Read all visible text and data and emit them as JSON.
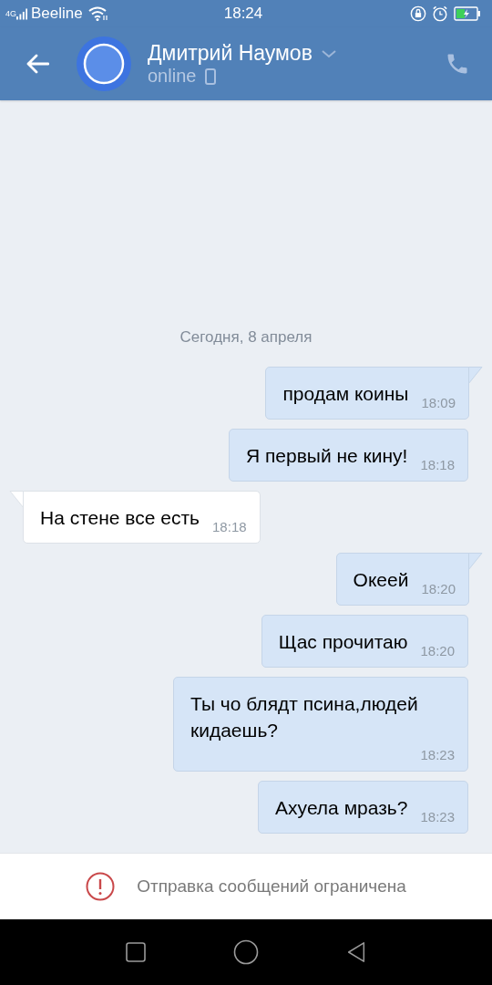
{
  "status_bar": {
    "network": "4G",
    "carrier": "Beeline",
    "time": "18:24"
  },
  "header": {
    "name": "Дмитрий Наумов",
    "status": "online"
  },
  "date_separator": "Сегодня, 8 апреля",
  "messages": [
    {
      "kind": "outgoing",
      "text": "продам коины",
      "time": "18:09",
      "tail": true
    },
    {
      "kind": "outgoing",
      "text": "Я первый не кину!",
      "time": "18:18",
      "tail": false
    },
    {
      "kind": "incoming",
      "text": "На стене все есть",
      "time": "18:18",
      "tail": true
    },
    {
      "kind": "outgoing",
      "text": "Океей",
      "time": "18:20",
      "tail": true
    },
    {
      "kind": "outgoing",
      "text": "Щас прочитаю",
      "time": "18:20",
      "tail": false
    },
    {
      "kind": "outgoing",
      "text": "Ты чо блядт псина,людей кидаешь?",
      "time": "18:23",
      "tail": false
    },
    {
      "kind": "outgoing",
      "text": "Ахуела мразь?",
      "time": "18:23",
      "tail": false
    }
  ],
  "restriction_notice": "Отправка сообщений ограничена"
}
